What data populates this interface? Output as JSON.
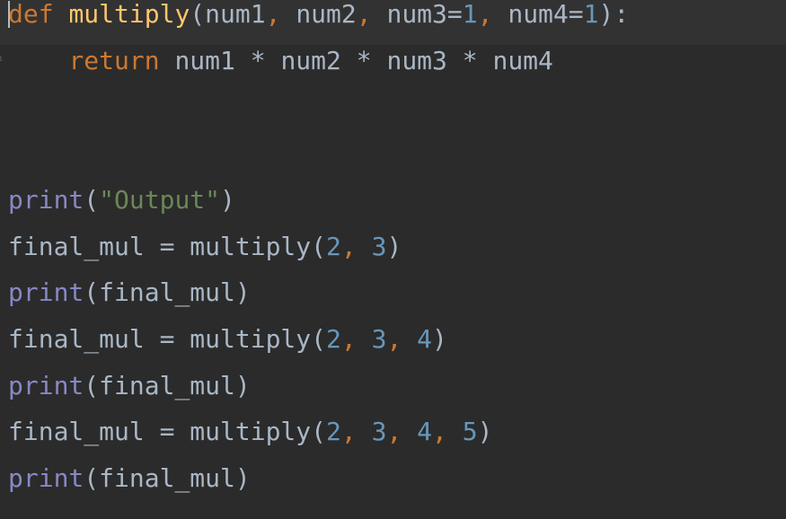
{
  "editor": {
    "language": "python",
    "colors": {
      "background": "#2b2b2b",
      "current_line": "#323232",
      "keyword": "#cc7832",
      "function_name": "#ffc66d",
      "builtin": "#8888c6",
      "number": "#6897bb",
      "string": "#6a8759",
      "text": "#a9b7c6"
    },
    "gutter_icon": "fold-marker-icon",
    "lines": [
      {
        "tokens": [
          {
            "t": "def",
            "c": "kw"
          },
          {
            "t": " ",
            "c": "plain"
          },
          {
            "t": "multiply",
            "c": "fn"
          },
          {
            "t": "(num1",
            "c": "plain"
          },
          {
            "t": ", ",
            "c": "punct"
          },
          {
            "t": "num2",
            "c": "plain"
          },
          {
            "t": ", ",
            "c": "punct"
          },
          {
            "t": "num3=",
            "c": "plain"
          },
          {
            "t": "1",
            "c": "num"
          },
          {
            "t": ", ",
            "c": "punct"
          },
          {
            "t": "num4=",
            "c": "plain"
          },
          {
            "t": "1",
            "c": "num"
          },
          {
            "t": "):",
            "c": "plain"
          }
        ]
      },
      {
        "tokens": [
          {
            "t": "    ",
            "c": "plain"
          },
          {
            "t": "return",
            "c": "kw"
          },
          {
            "t": " num1 * num2 * num3 * num4",
            "c": "plain"
          }
        ]
      },
      {
        "tokens": []
      },
      {
        "tokens": []
      },
      {
        "tokens": [
          {
            "t": "print",
            "c": "builtin"
          },
          {
            "t": "(",
            "c": "plain"
          },
          {
            "t": "\"Output\"",
            "c": "str"
          },
          {
            "t": ")",
            "c": "plain"
          }
        ]
      },
      {
        "tokens": [
          {
            "t": "final_mul = multiply(",
            "c": "plain"
          },
          {
            "t": "2",
            "c": "num"
          },
          {
            "t": ", ",
            "c": "punct"
          },
          {
            "t": "3",
            "c": "num"
          },
          {
            "t": ")",
            "c": "plain"
          }
        ]
      },
      {
        "tokens": [
          {
            "t": "print",
            "c": "builtin"
          },
          {
            "t": "(final_mul)",
            "c": "plain"
          }
        ]
      },
      {
        "tokens": [
          {
            "t": "final_mul = multiply(",
            "c": "plain"
          },
          {
            "t": "2",
            "c": "num"
          },
          {
            "t": ", ",
            "c": "punct"
          },
          {
            "t": "3",
            "c": "num"
          },
          {
            "t": ", ",
            "c": "punct"
          },
          {
            "t": "4",
            "c": "num"
          },
          {
            "t": ")",
            "c": "plain"
          }
        ]
      },
      {
        "tokens": [
          {
            "t": "print",
            "c": "builtin"
          },
          {
            "t": "(final_mul)",
            "c": "plain"
          }
        ]
      },
      {
        "tokens": [
          {
            "t": "final_mul = multiply(",
            "c": "plain"
          },
          {
            "t": "2",
            "c": "num"
          },
          {
            "t": ", ",
            "c": "punct"
          },
          {
            "t": "3",
            "c": "num"
          },
          {
            "t": ", ",
            "c": "punct"
          },
          {
            "t": "4",
            "c": "num"
          },
          {
            "t": ", ",
            "c": "punct"
          },
          {
            "t": "5",
            "c": "num"
          },
          {
            "t": ")",
            "c": "plain"
          }
        ]
      },
      {
        "tokens": [
          {
            "t": "print",
            "c": "builtin"
          },
          {
            "t": "(final_mul)",
            "c": "plain"
          }
        ]
      }
    ]
  }
}
